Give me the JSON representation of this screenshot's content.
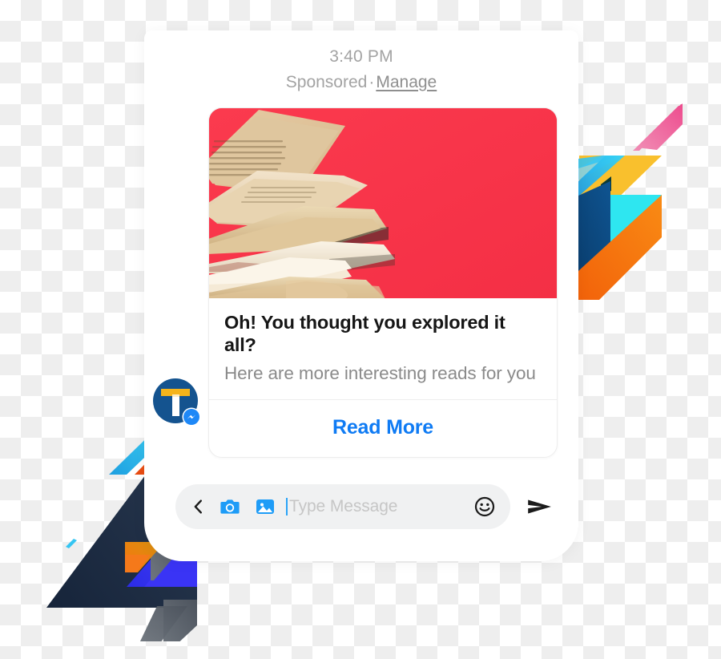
{
  "message": {
    "timestamp": "3:40 PM",
    "sponsored_label": "Sponsored",
    "separator": "·",
    "manage_link": "Manage"
  },
  "card": {
    "image_alt": "stack-of-books-on-red-background",
    "title": "Oh! You thought you explored it all?",
    "subtitle": "Here are more interesting reads for you",
    "cta_label": "Read More",
    "image_background_color": "#F8374B",
    "cta_color": "#0F7BF4"
  },
  "avatar": {
    "name": "sender-avatar",
    "letter": "T",
    "circle_color": "#14538F",
    "mark_color": "#F5B41B",
    "badge": "messenger-badge",
    "badge_color": "#1E88F7"
  },
  "composer": {
    "back_icon": "chevron-left-icon",
    "camera_icon": "camera-icon",
    "gallery_icon": "image-icon",
    "placeholder": "Type Message",
    "value": "",
    "emoji_icon": "smiley-icon",
    "send_icon": "send-icon",
    "pill_color": "#F0F1F2",
    "icon_accent_color": "#1E9CF7"
  },
  "decoration": {
    "right_shapes": [
      "pink-stripe",
      "yellow-triangle",
      "cyan-triangle",
      "navy-triangle",
      "orange-band",
      "sky-blue-stripe"
    ],
    "left_shapes": [
      "cyan-stripe",
      "orange-red-stripe",
      "navy-triangle",
      "magenta-shape",
      "blue-shape",
      "orange-stripe",
      "gray-stripe",
      "cyan-dash",
      "purple-dash"
    ],
    "colors": {
      "pink": "#EC5D96",
      "yellow": "#F9C02D",
      "cyan": "#2EE6F0",
      "sky": "#29BDEF",
      "navy": "#0E4B82",
      "dark_navy": "#1D2A3E",
      "orange": "#F57C18",
      "orange_red": "#F05A22",
      "blue": "#3333F0",
      "magenta": "#C9318E",
      "gray": "#5E6670"
    }
  }
}
